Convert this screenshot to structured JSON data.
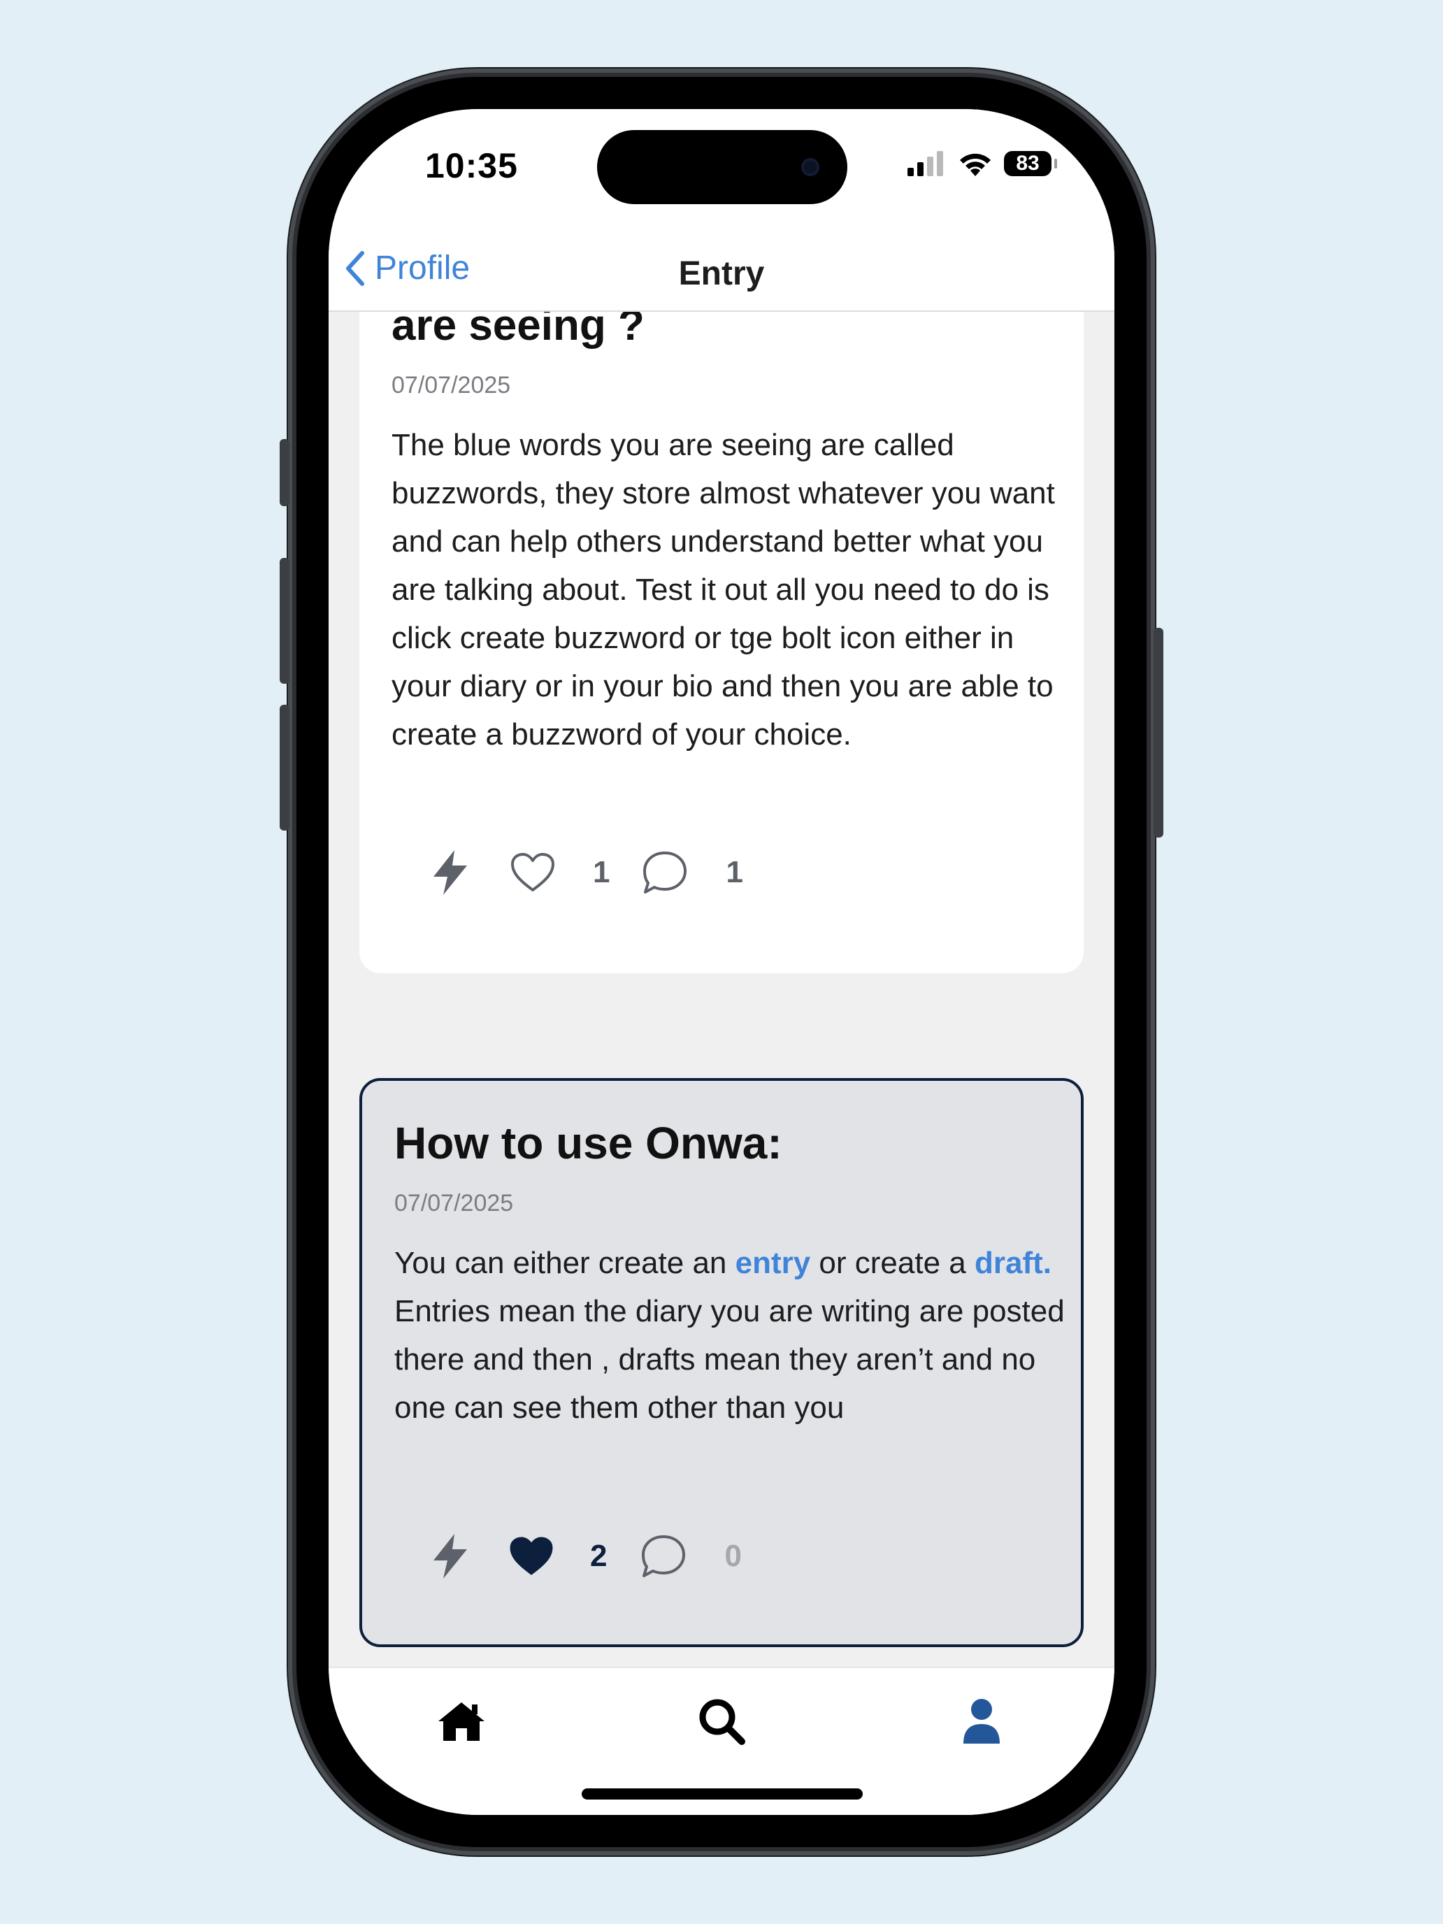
{
  "status_bar": {
    "time": "10:35",
    "battery": "83"
  },
  "nav": {
    "back_label": "Profile",
    "title": "Entry"
  },
  "entries": [
    {
      "title": "are seeing ?",
      "date": "07/07/2025",
      "body": "The blue words you are seeing are called buzzwords, they store almost whatever you want and can help others understand better what you are talking about. Test it out all you need to do is click create buzzword or tge bolt icon either in your diary or in your bio and then you are able to create a buzzword of your choice.",
      "likes": "1",
      "comments": "1",
      "liked": false
    },
    {
      "title": "How to use Onwa:",
      "date": "07/07/2025",
      "body_parts": {
        "p1": "You can either create an ",
        "link1": "entry",
        "p2": " or create a ",
        "link2": "draft.",
        "p3": " Entries mean the diary you are writing are posted there and then , drafts mean they aren’t and no one can see them other than you"
      },
      "likes": "2",
      "comments": "0",
      "liked": true
    }
  ],
  "tabbar": {
    "items": [
      "home-icon",
      "search-icon",
      "profile-icon"
    ],
    "active": "profile-icon"
  },
  "colors": {
    "accent": "#3f84d9",
    "navy": "#0c1f3d",
    "background": "#e2eff7"
  }
}
